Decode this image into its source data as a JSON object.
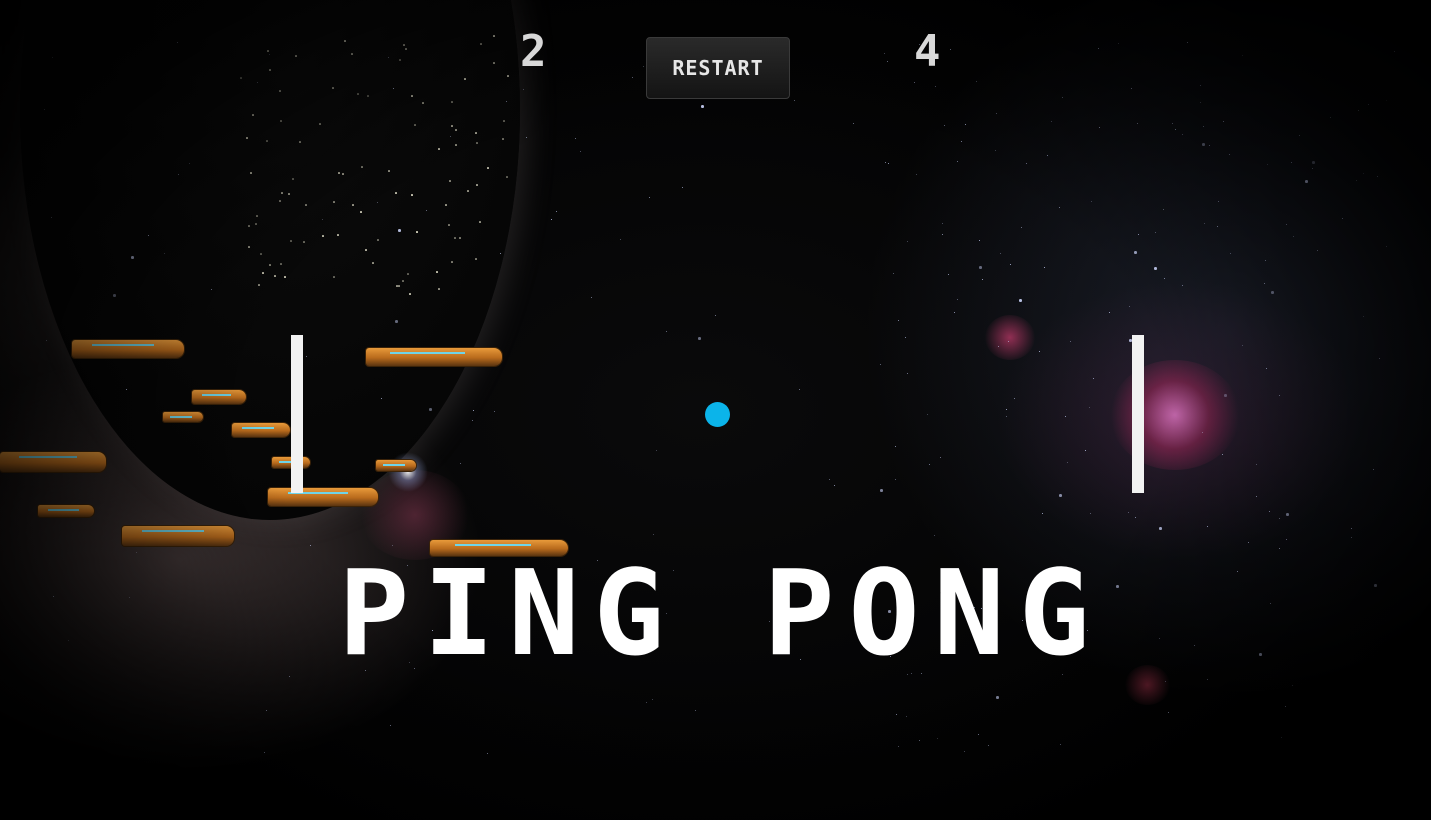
{
  "game": {
    "title": "PING PONG",
    "score_left": "2",
    "score_right": "4",
    "restart_label": "RESTART"
  },
  "colors": {
    "ball": "#0bb4ea",
    "paddle": "#f2f2f2",
    "title_text": "#ffffff",
    "score_text": "#d8d8d8",
    "ship_hull": "#e89a3a",
    "ship_stripe": "#6fd4e8"
  }
}
